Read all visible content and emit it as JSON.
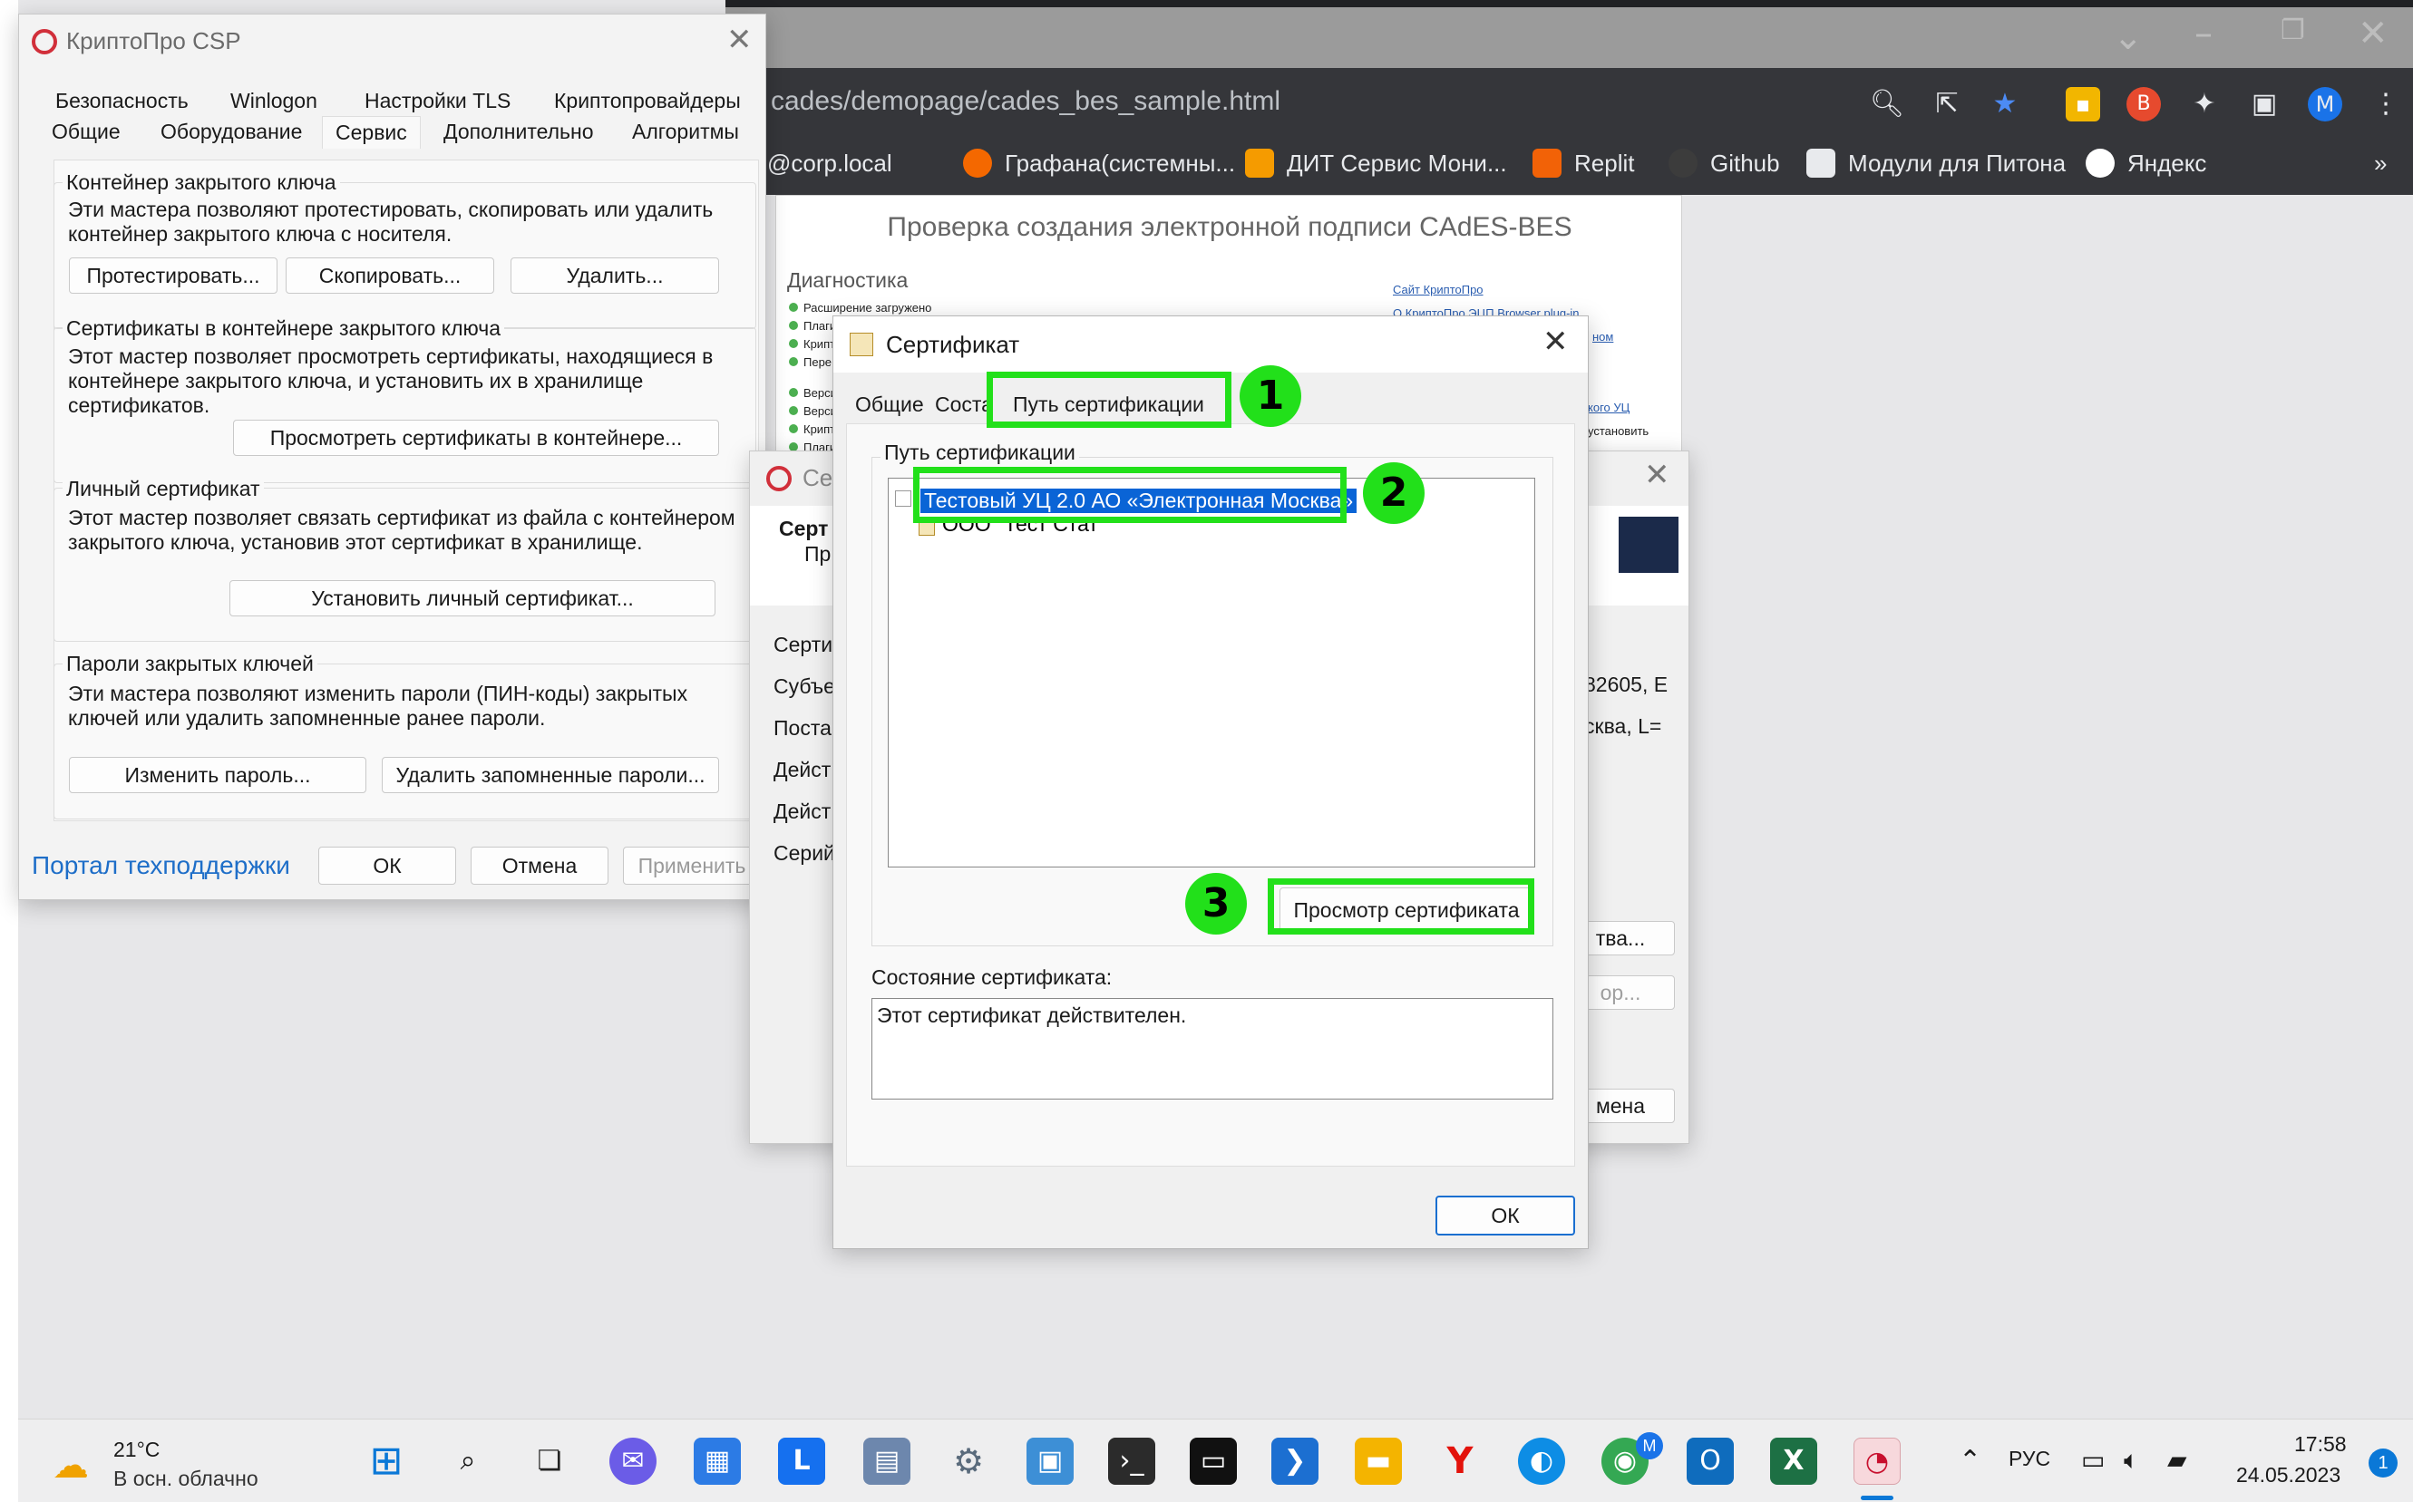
{
  "browser": {
    "url": "cades/demopage/cades_bes_sample.html",
    "profile_initial": "M",
    "bookmarks": [
      {
        "label": "@corp.local",
        "icon": "outlook-icon",
        "color": "#0f6cbd"
      },
      {
        "label": "Графана(системны...",
        "icon": "grafana-icon",
        "color": "#f46800"
      },
      {
        "label": "ДИТ Сервис Мони...",
        "icon": "dit-icon",
        "color": "#f59b00"
      },
      {
        "label": "Replit",
        "icon": "replit-icon",
        "color": "#f26207"
      },
      {
        "label": "Github",
        "icon": "github-icon",
        "color": "#3c3c3c"
      },
      {
        "label": "Модули для Питона",
        "icon": "cube-icon",
        "color": "#e8eaed"
      },
      {
        "label": "Яндекс",
        "icon": "yandex-icon",
        "color": "#ffffff"
      }
    ],
    "more": "»"
  },
  "page": {
    "title": "Проверка создания электронной подписи CAdES-BES",
    "diag_heading": "Диагностика",
    "diag_rows": [
      "Расширение загружено",
      "Плаги",
      "Крипт",
      "Пере",
      "Верси",
      "Верси",
      "Крипт",
      "Плаги"
    ],
    "links": [
      "Сайт КриптоПро",
      "О КриптоПро ЭЦП Browser plug-in",
      "ном",
      "кого УЦ",
      "установить"
    ]
  },
  "csp": {
    "title": "КриптоПро CSP",
    "tabs_row1": [
      "Безопасность",
      "Winlogon",
      "Настройки TLS",
      "Криптопровайдеры"
    ],
    "tabs_row2": [
      "Общие",
      "Оборудование",
      "Сервис",
      "Дополнительно",
      "Алгоритмы"
    ],
    "group1": {
      "title": "Контейнер закрытого ключа",
      "text": [
        "Эти мастера позволяют протестировать, скопировать или удалить",
        "контейнер закрытого ключа с носителя."
      ],
      "buttons": [
        "Протестировать...",
        "Скопировать...",
        "Удалить..."
      ]
    },
    "group2": {
      "title": "Сертификаты в контейнере закрытого ключа",
      "text": [
        "Этот мастер позволяет просмотреть сертификаты, находящиеся в",
        "контейнере закрытого ключа, и установить их в хранилище",
        "сертификатов."
      ],
      "button": "Просмотреть сертификаты в контейнере..."
    },
    "group3": {
      "title": "Личный сертификат",
      "text": [
        "Этот мастер позволяет связать сертификат из файла с контейнером",
        "закрытого ключа, установив этот сертификат в хранилище."
      ],
      "button": "Установить личный сертификат..."
    },
    "group4": {
      "title": "Пароли закрытых ключей",
      "text": [
        "Эти мастера позволяют изменить пароли (ПИН-коды) закрытых",
        "ключей или удалить запомненные ранее пароли."
      ],
      "buttons": [
        "Изменить пароль...",
        "Удалить запомненные пароли..."
      ]
    },
    "support_link": "Портал техподдержки",
    "ok": "ОК",
    "cancel": "Отмена",
    "apply": "Применить"
  },
  "midwin": {
    "title_frag": "Сер",
    "heading_frag": "Серт",
    "sub_frag": "Пр",
    "rows": [
      "Серти",
      "Субъе",
      "Постав",
      "Дейст",
      "Дейст",
      "Серий"
    ],
    "right_vals": [
      "82605, E",
      "сква, L="
    ],
    "btn1": "тва...",
    "btn2": "ор...",
    "btn3": "мена"
  },
  "cert": {
    "title": "Сертификат",
    "tabs": [
      "Общие",
      "Соста",
      "Путь сертификации"
    ],
    "group_label": "Путь сертификации",
    "tree": [
      "Тестовый УЦ 2.0 АО «Электронная Москва»",
      "ООО \"Тест Стат"
    ],
    "view_button": "Просмотр сертификата",
    "status_label": "Состояние сертификата:",
    "status_text": "Этот сертификат действителен.",
    "ok": "ОК"
  },
  "badges": [
    "1",
    "2",
    "3"
  ],
  "taskbar": {
    "weather_temp": "21°C",
    "weather_desc": "В осн. облачно",
    "lang": "РУС",
    "time": "17:58",
    "date": "24.05.2023",
    "notif_count": "1",
    "chrome_badge": "M"
  }
}
